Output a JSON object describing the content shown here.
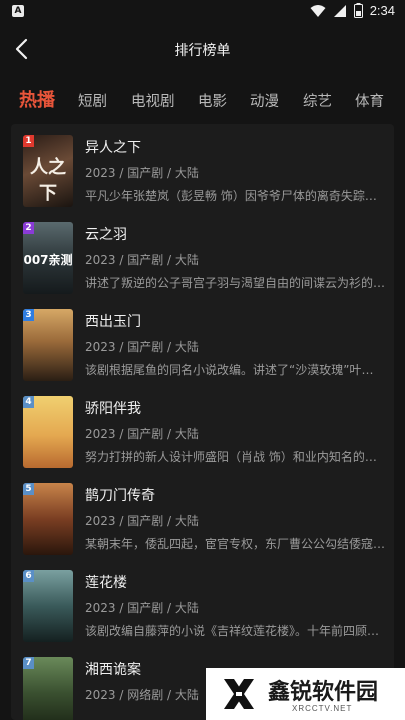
{
  "status": {
    "app_icon": "A",
    "time": "2:34",
    "icons": [
      "wifi-icon",
      "signal-icon",
      "battery-icon"
    ]
  },
  "header": {
    "title": "排行榜单",
    "back_icon": "chevron-left-icon"
  },
  "tabs": [
    {
      "label": "热播",
      "active": true
    },
    {
      "label": "短剧",
      "active": false
    },
    {
      "label": "电视剧",
      "active": false
    },
    {
      "label": "电影",
      "active": false
    },
    {
      "label": "动漫",
      "active": false
    },
    {
      "label": "综艺",
      "active": false
    },
    {
      "label": "体育",
      "active": false
    }
  ],
  "items": [
    {
      "rank": "1",
      "name": "异人之下",
      "meta": "2023 / 国产剧 / 大陆",
      "desc": "平凡少年张楚岚（彭昱畅 饰）因爷爷尸体的离奇失踪…",
      "poster_text": "",
      "rank_color": "#e0392e",
      "poster_colors": [
        "#2b1d17",
        "#5a3b2a"
      ]
    },
    {
      "rank": "2",
      "name": "云之羽",
      "meta": "2023 / 国产剧 / 大陆",
      "desc": "讲述了叛逆的公子哥宫子羽与渴望自由的间谍云为衫的…",
      "poster_text": "007亲测",
      "rank_color": "#8a3bd6",
      "poster_colors": [
        "#3d4a4e",
        "#1e2326"
      ]
    },
    {
      "rank": "3",
      "name": "西出玉门",
      "meta": "2023 / 国产剧 / 大陆",
      "desc": "该剧根据尾鱼的同名小说改编。讲述了“沙漠玫瑰”叶流…",
      "poster_text": "",
      "rank_color": "#2f7de0",
      "poster_colors": [
        "#b8864a",
        "#3a2a1a"
      ]
    },
    {
      "rank": "4",
      "name": "骄阳伴我",
      "meta": "2023 / 国产剧 / 大陆",
      "desc": "努力打拼的新人设计师盛阳（肖战 饰）和业内知名的…",
      "poster_text": "",
      "rank_color": "#5a8fc6",
      "poster_colors": [
        "#e8c86a",
        "#c8783a"
      ]
    },
    {
      "rank": "5",
      "name": "鹊刀门传奇",
      "meta": "2023 / 国产剧 / 大陆",
      "desc": "某朝末年，倭乱四起，宦官专权，东厂曹公公勾结倭寇…",
      "poster_text": "",
      "rank_color": "#5a8fc6",
      "poster_colors": [
        "#8a4a2a",
        "#3a1e12"
      ]
    },
    {
      "rank": "6",
      "name": "莲花楼",
      "meta": "2023 / 国产剧 / 大陆",
      "desc": "该剧改编自藤萍的小说《吉祥纹莲花楼》。十年前四顾…",
      "poster_text": "",
      "rank_color": "#5a8fc6",
      "poster_colors": [
        "#4a6a6a",
        "#1a2a2a"
      ]
    },
    {
      "rank": "7",
      "name": "湘西诡案",
      "meta": "2023 / 网络剧 / 大陆",
      "desc": "",
      "poster_text": "",
      "rank_color": "#5a8fc6",
      "poster_colors": [
        "#5a7a4a",
        "#2a3a22"
      ]
    }
  ],
  "watermark": {
    "text": "鑫锐软件园",
    "sub": "XRCCTV.NET"
  }
}
